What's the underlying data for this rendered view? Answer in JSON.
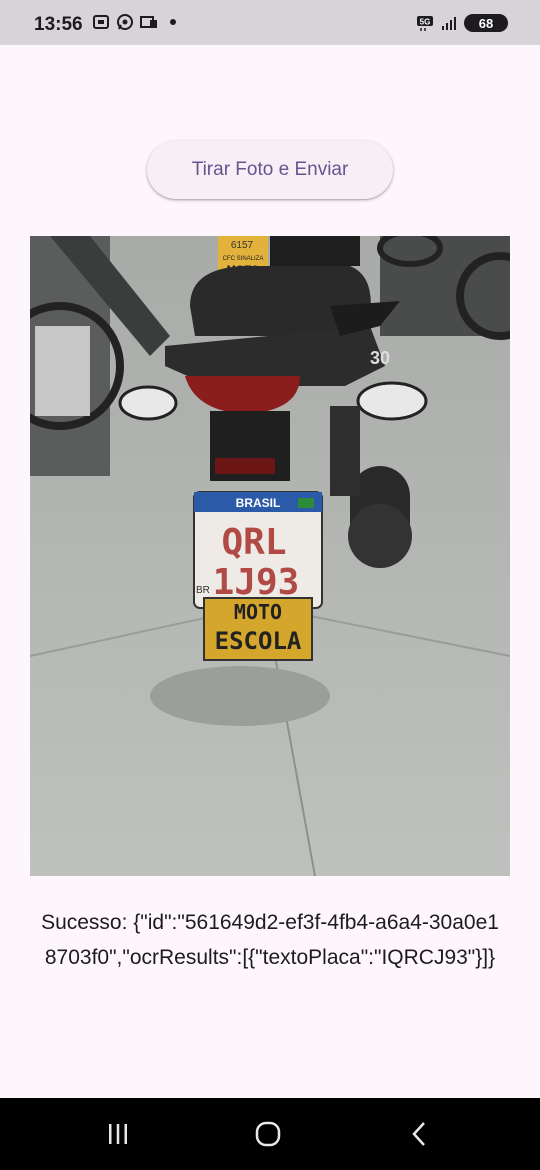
{
  "status_bar": {
    "time": "13:56",
    "network": "5G",
    "battery": "68",
    "icons": [
      "screenshot-icon",
      "whatsapp-icon",
      "notification-icon",
      "signal-icon",
      "battery-icon"
    ]
  },
  "app": {
    "primary_button_label": "Tirar Foto e Enviar",
    "result_text": "Sucesso: {\"id\":\"561649d2-ef3f-4fb4-a6a4-30a0e18703f0\",\"ocrResults\":[{\"textoPlaca\":\"IQRCJ93\"}]}"
  },
  "photo": {
    "description_icon": "motorcycle-photo",
    "plate_country": "BRASIL",
    "plate_line1": "QRL",
    "plate_line2": "1J93",
    "sign_line1": "MOTO",
    "sign_line2": "ESCOLA",
    "top_sign_number": "6157",
    "top_sign_line1": "CFC SINALIZA",
    "top_sign_line2": "MOTO",
    "side_number": "30",
    "plate_side": "BR"
  },
  "nav_bar": {
    "icons": [
      "recents-icon",
      "home-icon",
      "back-icon"
    ]
  },
  "colors": {
    "background": "#fdf7fd",
    "button_text": "#65558f",
    "status_bar": "#d8d3d9"
  }
}
